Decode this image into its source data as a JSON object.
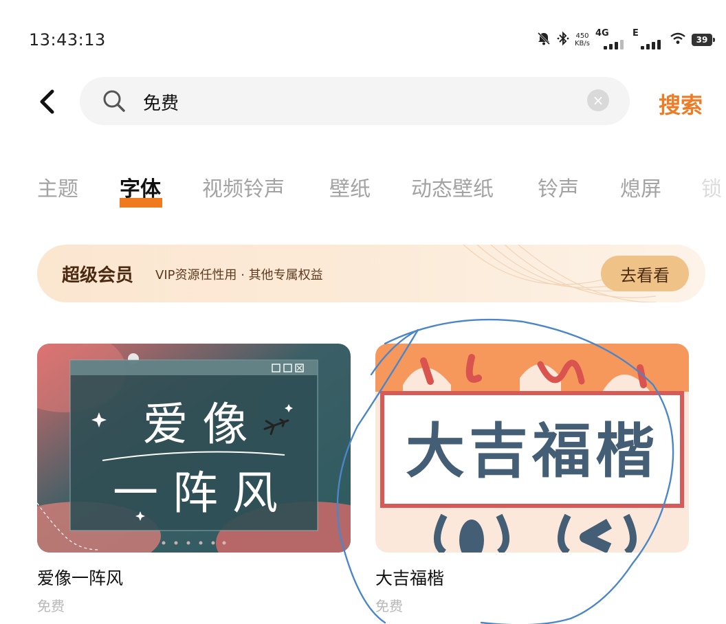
{
  "status": {
    "time": "13:43:13",
    "speed_value": "450",
    "speed_unit": "KB/s",
    "net1": "4G",
    "net2": "E",
    "battery": "39"
  },
  "search": {
    "query": "免费",
    "clear_symbol": "×",
    "button_label": "搜索"
  },
  "tabs": [
    "主题",
    "字体",
    "视频铃声",
    "壁纸",
    "动态壁纸",
    "铃声",
    "熄屏",
    "锁"
  ],
  "active_tab": "字体",
  "vip": {
    "title": "超级会员",
    "desc": "VIP资源任性用 · 其他专属权益",
    "button": "去看看"
  },
  "cards": [
    {
      "name": "爱像一阵风",
      "price": "免费",
      "art_line1": "爱 像",
      "art_line2": "一 阵 风"
    },
    {
      "name": "大吉福楷",
      "price": "免费",
      "art_text": "大吉福楷"
    }
  ],
  "colors": {
    "accent": "#ee7c25",
    "tab_indicator": "#f07a1e",
    "vip_button": "#efc288",
    "annotation_stroke": "#4a86c8"
  },
  "icons": [
    "back-chevron-icon",
    "search-icon",
    "clear-icon",
    "mute-icon",
    "bluetooth-icon",
    "signal-icon",
    "wifi-icon",
    "battery-icon",
    "airplane-icon",
    "sparkle-icon"
  ]
}
